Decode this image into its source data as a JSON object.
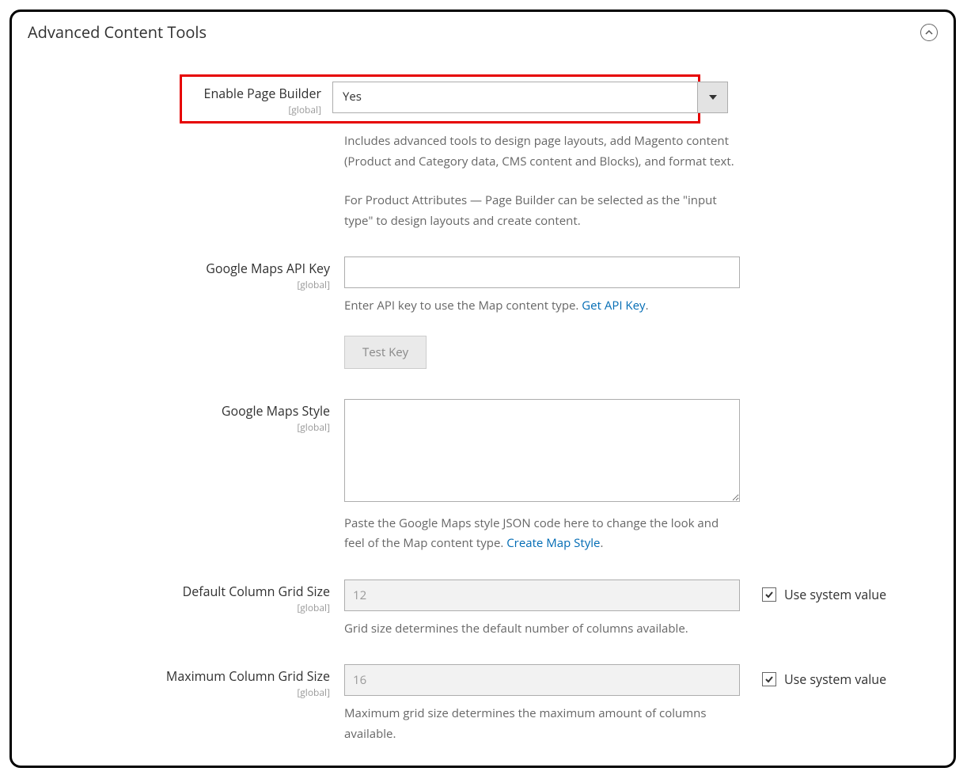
{
  "section_title": "Advanced Content Tools",
  "scope_label": "[global]",
  "use_system_value": "Use system value",
  "fields": {
    "enable_page_builder": {
      "label": "Enable Page Builder",
      "value": "Yes",
      "help1": "Includes advanced tools to design page layouts, add Magento content (Product and Category data, CMS content and Blocks), and format text.",
      "help2": "For Product Attributes — Page Builder can be selected as the \"input type\" to design layouts and create content."
    },
    "gmaps_api_key": {
      "label": "Google Maps API Key",
      "value": "",
      "help_prefix": "Enter API key to use the Map content type. ",
      "link_text": "Get API Key",
      "period": ".",
      "test_btn": "Test Key"
    },
    "gmaps_style": {
      "label": "Google Maps Style",
      "value": "",
      "help_prefix": "Paste the Google Maps style JSON code here to change the look and feel of the Map content type. ",
      "link_text": "Create Map Style",
      "period": "."
    },
    "default_grid": {
      "label": "Default Column Grid Size",
      "value": "12",
      "help": "Grid size determines the default number of columns available."
    },
    "max_grid": {
      "label": "Maximum Column Grid Size",
      "value": "16",
      "help": "Maximum grid size determines the maximum amount of columns available."
    }
  }
}
